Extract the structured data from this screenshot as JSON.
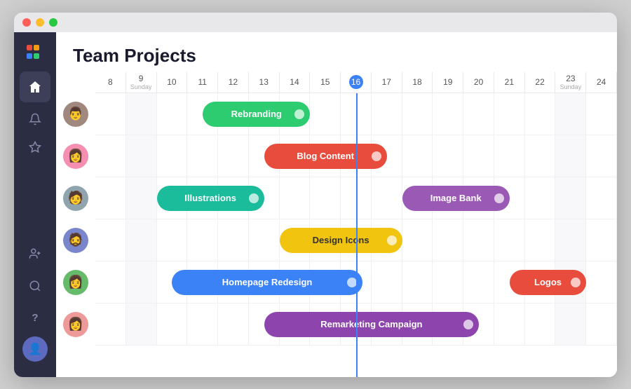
{
  "window": {
    "title": "Team Projects"
  },
  "sidebar": {
    "logo": "≡",
    "items": [
      {
        "name": "home",
        "icon": "⌂",
        "active": true
      },
      {
        "name": "notifications",
        "icon": "🔔"
      },
      {
        "name": "favorites",
        "icon": "★"
      },
      {
        "name": "add-user",
        "icon": "👤+"
      },
      {
        "name": "search",
        "icon": "🔍"
      },
      {
        "name": "help",
        "icon": "?"
      }
    ]
  },
  "header": {
    "title": "Team Projects"
  },
  "timeline": {
    "days": [
      {
        "num": "8",
        "name": "",
        "weekend": false
      },
      {
        "num": "9",
        "name": "Sunday",
        "weekend": true
      },
      {
        "num": "10",
        "name": "",
        "weekend": false
      },
      {
        "num": "11",
        "name": "",
        "weekend": false
      },
      {
        "num": "12",
        "name": "",
        "weekend": false
      },
      {
        "num": "13",
        "name": "",
        "weekend": false
      },
      {
        "num": "14",
        "name": "",
        "weekend": false
      },
      {
        "num": "15",
        "name": "",
        "weekend": false
      },
      {
        "num": "16",
        "name": "",
        "today": true,
        "weekend": false
      },
      {
        "num": "17",
        "name": "",
        "weekend": false
      },
      {
        "num": "18",
        "name": "",
        "weekend": false
      },
      {
        "num": "19",
        "name": "",
        "weekend": false
      },
      {
        "num": "20",
        "name": "",
        "weekend": false
      },
      {
        "num": "21",
        "name": "",
        "weekend": false
      },
      {
        "num": "22",
        "name": "",
        "weekend": false
      },
      {
        "num": "23",
        "name": "Sunday",
        "weekend": true
      },
      {
        "num": "24",
        "name": "",
        "weekend": false
      }
    ]
  },
  "tasks": [
    {
      "label": "Rebranding",
      "color": "bar-green",
      "row": 0,
      "startCol": 3.5,
      "widthCols": 3.5
    },
    {
      "label": "Blog Content",
      "color": "bar-red",
      "row": 1,
      "startCol": 5.5,
      "widthCols": 4
    },
    {
      "label": "Illustrations",
      "color": "bar-teal",
      "row": 2,
      "startCol": 2,
      "widthCols": 3.5
    },
    {
      "label": "Image Bank",
      "color": "bar-purple",
      "row": 2,
      "startCol": 10,
      "widthCols": 3.5
    },
    {
      "label": "Design Icons",
      "color": "bar-yellow",
      "row": 3,
      "startCol": 6,
      "widthCols": 4
    },
    {
      "label": "Homepage Redesign",
      "color": "bar-blue",
      "row": 4,
      "startCol": 2.5,
      "widthCols": 6.2
    },
    {
      "label": "Logos",
      "color": "bar-darkred",
      "row": 4,
      "startCol": 13.5,
      "widthCols": 2.5
    },
    {
      "label": "Remarketing Campaign",
      "color": "bar-violet",
      "row": 5,
      "startCol": 5.5,
      "widthCols": 7
    }
  ],
  "avatars": [
    {
      "emoji": "👨",
      "bg": "#8d6e63"
    },
    {
      "emoji": "👩",
      "bg": "#f48fb1"
    },
    {
      "emoji": "👨‍💼",
      "bg": "#78909c"
    },
    {
      "emoji": "🧔",
      "bg": "#7986cb"
    },
    {
      "emoji": "👩‍🦱",
      "bg": "#66bb6a"
    },
    {
      "emoji": "👩‍🦰",
      "bg": "#ef9a9a"
    }
  ]
}
